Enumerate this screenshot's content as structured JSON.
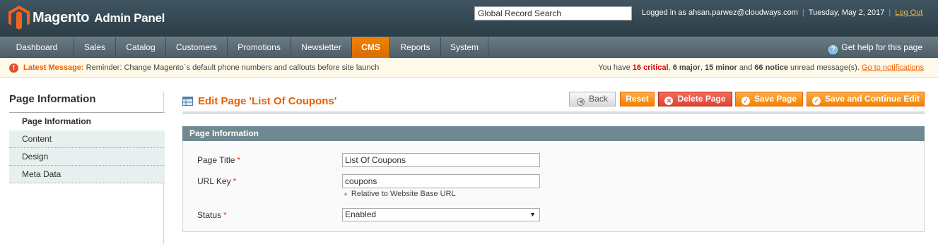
{
  "header": {
    "brand": "Magento",
    "brand_sub": "Admin Panel",
    "search_value": "Global Record Search",
    "logged_in": "Logged in as ahsan.parwez@cloudways.com",
    "date": "Tuesday, May 2, 2017",
    "logout": "Log Out"
  },
  "nav": {
    "items": [
      "Dashboard",
      "Sales",
      "Catalog",
      "Customers",
      "Promotions",
      "Newsletter",
      "CMS",
      "Reports",
      "System"
    ],
    "active": "CMS",
    "help": "Get help for this page"
  },
  "message": {
    "label": "Latest Message:",
    "text": "Reminder: Change Magento`s default phone numbers and callouts before site launch",
    "summary_prefix": "You have",
    "critical": "16 critical",
    "major": "6 major",
    "minor": "15 minor",
    "and": "and",
    "notice": "66 notice",
    "summary_suffix": "unread message(s).",
    "link": "Go to notifications"
  },
  "sidebar": {
    "title": "Page Information",
    "items": [
      "Page Information",
      "Content",
      "Design",
      "Meta Data"
    ]
  },
  "main": {
    "heading": "Edit Page 'List Of Coupons'",
    "buttons": {
      "back": "Back",
      "reset": "Reset",
      "delete": "Delete Page",
      "save": "Save Page",
      "save_continue": "Save and Continue Edit"
    },
    "fieldset_title": "Page Information",
    "fields": {
      "page_title_label": "Page Title",
      "page_title_value": "List Of Coupons",
      "url_key_label": "URL Key",
      "url_key_value": "coupons",
      "url_key_note": "Relative to Website Base URL",
      "status_label": "Status",
      "status_value": "Enabled"
    },
    "required_mark": "*"
  },
  "colors": {
    "accent": "#eb5e00",
    "header_bg": "#2c3e47",
    "fieldset_head": "#6f8992"
  }
}
